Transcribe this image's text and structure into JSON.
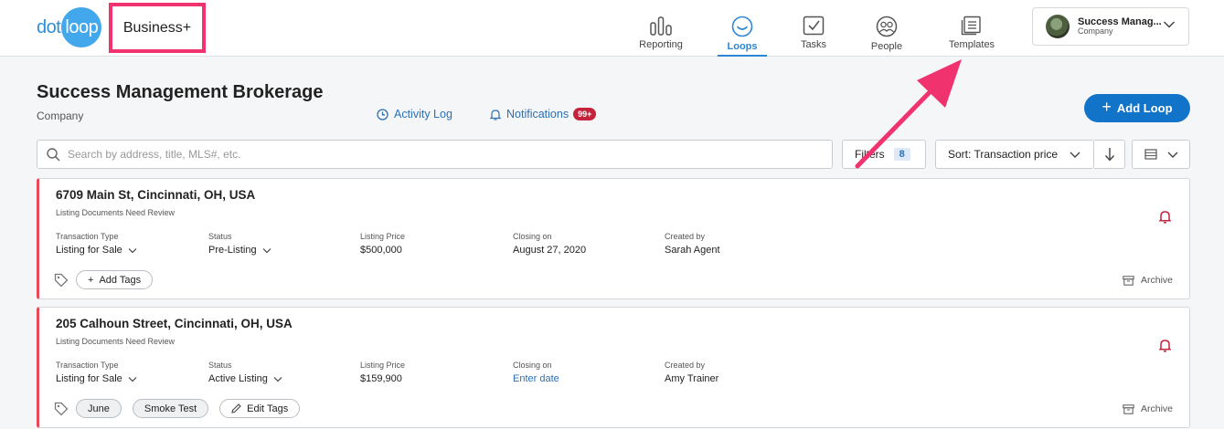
{
  "brand": {
    "logo_left": "dot",
    "logo_right": "loop",
    "plan": "Business+"
  },
  "nav": [
    {
      "id": "reporting",
      "label": "Reporting",
      "icon": "bar-chart-icon",
      "active": false
    },
    {
      "id": "loops",
      "label": "Loops",
      "icon": "smile-circle-icon",
      "active": true
    },
    {
      "id": "tasks",
      "label": "Tasks",
      "icon": "checkbox-icon",
      "active": false
    },
    {
      "id": "people",
      "label": "People",
      "icon": "people-icon",
      "active": false
    },
    {
      "id": "templates",
      "label": "Templates",
      "icon": "templates-icon",
      "active": false
    }
  ],
  "account": {
    "name": "Success Manag...",
    "role": "Company"
  },
  "page": {
    "title": "Success Management Brokerage",
    "subtitle": "Company",
    "activity_log": "Activity Log",
    "notifications": "Notifications",
    "notifications_badge": "99+",
    "add_loop": "Add Loop"
  },
  "toolbar": {
    "search_placeholder": "Search by address, title, MLS#, etc.",
    "filters_label": "Filters",
    "filters_count": "8",
    "sort_label": "Sort: Transaction price"
  },
  "loops": [
    {
      "address": "6709 Main St, Cincinnati, OH, USA",
      "status_message": "Listing Documents Need Review",
      "fields": [
        {
          "label": "Transaction Type",
          "value": "Listing for Sale",
          "dropdown": true
        },
        {
          "label": "Status",
          "value": "Pre-Listing",
          "dropdown": true
        },
        {
          "label": "Listing Price",
          "value": "$500,000"
        },
        {
          "label": "Closing on",
          "value": "August 27, 2020"
        },
        {
          "label": "Created by",
          "value": "Sarah Agent"
        }
      ],
      "tags": [],
      "tag_button": "Add Tags",
      "archive": "Archive"
    },
    {
      "address": "205 Calhoun Street, Cincinnati, OH, USA",
      "status_message": "Listing Documents Need Review",
      "fields": [
        {
          "label": "Transaction Type",
          "value": "Listing for Sale",
          "dropdown": true
        },
        {
          "label": "Status",
          "value": "Active Listing",
          "dropdown": true
        },
        {
          "label": "Listing Price",
          "value": "$159,900"
        },
        {
          "label": "Closing on",
          "value": "Enter date",
          "link": true
        },
        {
          "label": "Created by",
          "value": "Amy Trainer"
        }
      ],
      "tags": [
        "June",
        "Smoke Test"
      ],
      "tag_button": "Edit Tags",
      "archive": "Archive"
    }
  ],
  "colors": {
    "accent": "#1274c8",
    "annotation": "#f0336f",
    "alert": "#c5223b"
  }
}
